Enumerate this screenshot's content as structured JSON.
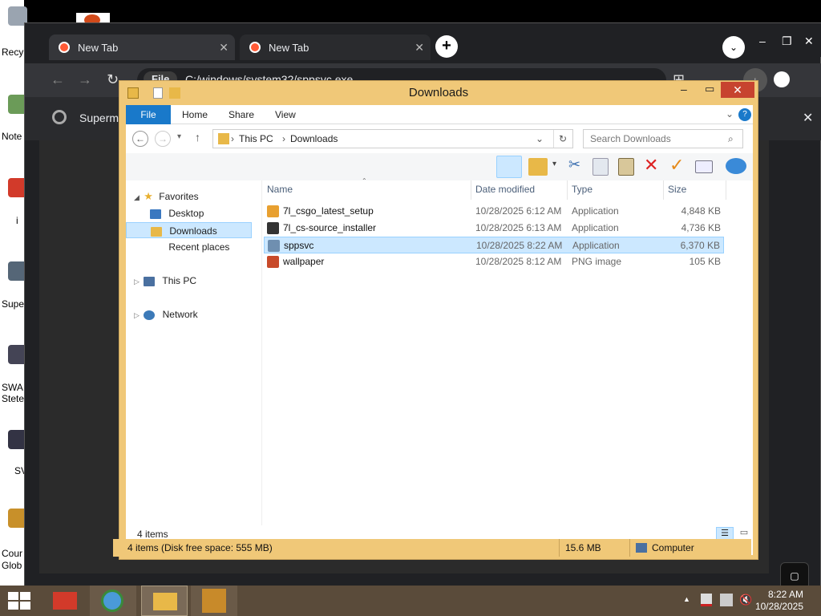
{
  "desktop": {
    "icons": [
      {
        "label": "Recy"
      },
      {
        "label": "Note"
      },
      {
        "label": "i"
      },
      {
        "label": "Supe"
      },
      {
        "label": "SWA"
      },
      {
        "label": "Stete"
      },
      {
        "label": "SV"
      },
      {
        "label": "Cour"
      },
      {
        "label": "Glob"
      }
    ]
  },
  "chrome": {
    "tabs": [
      {
        "label": "New Tab",
        "close": "✕"
      },
      {
        "label": "New Tab",
        "close": "✕"
      }
    ],
    "new_tab": "+",
    "chevron": "⌄",
    "window_controls": {
      "min": "–",
      "max": "❐",
      "close": "✕"
    },
    "nav": {
      "back": "←",
      "forward": "→",
      "reload": "↻"
    },
    "omnibox": {
      "chip": "File",
      "url": "C:/windows/system32/sppsvc.exe"
    },
    "infobar": {
      "text": "Supermi",
      "close": "✕"
    }
  },
  "explorer": {
    "title": "Downloads",
    "controls": {
      "min": "–",
      "max": "▭",
      "close": "✕"
    },
    "ribbon_tabs": [
      "File",
      "Home",
      "Share",
      "View"
    ],
    "breadcrumb": [
      "This PC",
      "Downloads"
    ],
    "search_placeholder": "Search Downloads",
    "nav_pane": {
      "favorites": "Favorites",
      "desktop": "Desktop",
      "downloads": "Downloads",
      "recent": "Recent places",
      "this_pc": "This PC",
      "network": "Network"
    },
    "columns": {
      "name": "Name",
      "date": "Date modified",
      "type": "Type",
      "size": "Size"
    },
    "files": [
      {
        "name": "7l_csgo_latest_setup",
        "date": "10/28/2025 6:12 AM",
        "type": "Application",
        "size": "4,848 KB",
        "icon_color": "#e8a030",
        "selected": false
      },
      {
        "name": "7l_cs-source_installer",
        "date": "10/28/2025 6:13 AM",
        "type": "Application",
        "size": "4,736 KB",
        "icon_color": "#333333",
        "selected": false
      },
      {
        "name": "sppsvc",
        "date": "10/28/2025 8:22 AM",
        "type": "Application",
        "size": "6,370 KB",
        "icon_color": "#6f8fb0",
        "selected": true
      },
      {
        "name": "wallpaper",
        "date": "10/28/2025 8:12 AM",
        "type": "PNG image",
        "size": "105 KB",
        "icon_color": "#c84a2a",
        "selected": false
      }
    ],
    "status": {
      "items": "4 items"
    },
    "details": {
      "summary": "4 items (Disk free space: 555 MB)",
      "size": "15.6 MB",
      "location": "Computer"
    }
  },
  "taskbar": {
    "clock_time": "8:22 AM",
    "clock_date": "10/28/2025",
    "tray_up": "▲"
  },
  "colors": {
    "explorer_frame": "#f0c878",
    "accent": "#1979ca",
    "close_red": "#c7432f",
    "selection": "#cce8ff"
  }
}
